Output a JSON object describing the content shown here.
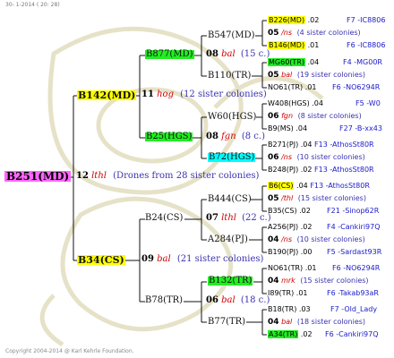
{
  "header": {
    "date": "30- 1-2014 ( 20: 28)"
  },
  "footer": {
    "copyright": "Copyright 2004-2014 @ Karl Kehrle Foundation."
  },
  "root": {
    "name": "B251(MD)",
    "gen": "12",
    "code": "lthl",
    "note": "(Drones from 28 sister colonies)"
  },
  "gen1": {
    "upper": {
      "name": "B142(MD)",
      "gen": "11",
      "code": "hog",
      "sis": "(12 sister colonies)"
    },
    "lower": {
      "name": "B34(CS)",
      "gen": "09",
      "code": "bal",
      "sis": "(21 sister colonies)"
    }
  },
  "gen2": {
    "a": {
      "name": "B877(MD)",
      "gen": "08",
      "code": "bal",
      "sis": "(15 c.)"
    },
    "b": {
      "name": "B25(HGS)",
      "gen": "08",
      "code": "fgn",
      "sis": "(8 c.)"
    },
    "c": {
      "name": "B24(CS)",
      "gen": "07",
      "code": "lthl",
      "sis": "(22 c.)"
    },
    "d": {
      "name": "B78(TR)",
      "gen": "06",
      "code": "bal",
      "sis": "(18 c.)"
    }
  },
  "gen3": {
    "a1": "B547(MD)",
    "a2": "B110(TR)",
    "b1": "W60(HGS)",
    "b2": "B72(HGS)",
    "c1": "B444(CS)",
    "c2": "A284(PJ)",
    "d1": "B132(TR)",
    "d2": "B77(TR)"
  },
  "right_rows": [
    {
      "name": "B226(MD)",
      "year": ".02",
      "ref": "F7 -IC8806"
    },
    {
      "gen": "05",
      "code": "/ns",
      "sis": "(4 sister colonies)"
    },
    {
      "name": "B146(MD)",
      "year": ".01",
      "ref": "F6 -IC8806"
    },
    {
      "name": "MG60(TR)",
      "year": ".04",
      "ref": "F4 -MG00R"
    },
    {
      "gen": "05",
      "code": "bal",
      "sis": "(19 sister colonies)"
    },
    {
      "name": "NO61(TR)",
      "year": ".01",
      "ref": "F6 -NO6294R"
    },
    {
      "name": "W408(HGS)",
      "year": ".04",
      "ref": "F5 -W0"
    },
    {
      "gen": "06",
      "code": "fgn",
      "sis": "(8 sister colonies)"
    },
    {
      "name": "B9(MS)",
      "year": ".04",
      "ref": "F27 -B-xx43"
    },
    {
      "name": "B271(PJ)",
      "year": ".04",
      "ref": "F13 -AthosSt80R"
    },
    {
      "gen": "06",
      "code": "/ns",
      "sis": "(10 sister colonies)"
    },
    {
      "name": "B248(PJ)",
      "year": ".02",
      "ref": "F13 -AthosSt80R"
    },
    {
      "name": "B6(CS)",
      "year": ".04",
      "ref": "F13 -AthosSt80R"
    },
    {
      "gen": "05",
      "code": "/thl",
      "sis": "(15 sister colonies)"
    },
    {
      "name": "B35(CS)",
      "year": ".02",
      "ref": "F21 -Sinop62R"
    },
    {
      "name": "A256(PJ)",
      "year": ".02",
      "ref": "F4 -Cankiri97Q"
    },
    {
      "gen": "04",
      "code": "/ns",
      "sis": "(10 sister colonies)"
    },
    {
      "name": "B190(PJ)",
      "year": ".00",
      "ref": "F5 -Sardast93R"
    },
    {
      "name": "NO61(TR)",
      "year": ".01",
      "ref": "F6 -NO6294R"
    },
    {
      "gen": "04",
      "code": "mrk",
      "sis": "(15 sister colonies)"
    },
    {
      "name": "I89(TR)",
      "year": ".01",
      "ref": "F6 -Takab93aR"
    },
    {
      "name": "B18(TR)",
      "year": ".03",
      "ref": "F7 -Old_Lady"
    },
    {
      "gen": "04",
      "code": "bal",
      "sis": "(18 sister colonies)"
    },
    {
      "name": "A34(TR)",
      "year": ".02",
      "ref": "F6 -Cankiri97Q"
    }
  ]
}
